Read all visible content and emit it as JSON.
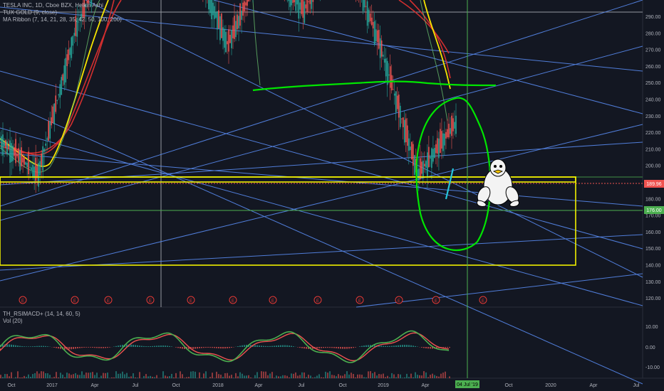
{
  "legend": {
    "symbol_line": "TESLA INC, 1D, Cboe BZX, Heikin Ashi",
    "indicator_1": "TUX GOLD (9, close)",
    "indicator_2": "MA Ribbon (7, 14, 21, 28, 35, 42, 50, 100, 200)",
    "oscillator_1": "TH_RSIMACD+ (14, 14, 60, 5)",
    "oscillator_2": "Vol (20)"
  },
  "price_axis": {
    "ticks": [
      "290.00",
      "280.00",
      "270.00",
      "260.00",
      "250.00",
      "240.00",
      "230.00",
      "220.00",
      "210.00",
      "200.00",
      "190.00",
      "180.00",
      "170.00",
      "160.00",
      "150.00",
      "140.00",
      "130.00",
      "120.00"
    ],
    "last_price_label": "189.96",
    "level_label": "176.00",
    "last_price_color": "#ef5350",
    "level_color": "#4caf50"
  },
  "osc_axis": {
    "ticks": [
      "10.00",
      "0.00",
      "-10.00"
    ]
  },
  "time_axis": {
    "ticks": [
      "Oct",
      "2017",
      "Apr",
      "Jul",
      "Oct",
      "2018",
      "Apr",
      "Jul",
      "Oct",
      "2019",
      "Apr",
      "Jul",
      "Oct",
      "2020",
      "Apr",
      "Jul"
    ],
    "crosshair_label": "04 Jul '19",
    "crosshair_color": "#4caf50"
  },
  "events": {
    "marker_label": "E",
    "count": 13
  },
  "chart_data": {
    "type": "line",
    "symbol": "TSLA",
    "x": [
      "2016-10",
      "2017-01",
      "2017-04",
      "2017-07",
      "2017-10",
      "2018-01",
      "2018-04",
      "2018-07",
      "2018-10",
      "2019-01",
      "2019-04",
      "2019-06",
      "2019-07"
    ],
    "series": [
      {
        "values": [
          215,
          195,
          280,
          330,
          350,
          325,
          270,
          320,
          290,
          330,
          270,
          195,
          225
        ]
      }
    ],
    "ylim": [
      118,
      296
    ],
    "levels": {
      "yellow_box_top": 195,
      "yellow_box_bottom": 143,
      "green_horizontal": 176,
      "last_price": 189.96
    },
    "grid": false,
    "colors": {
      "background": "#131722",
      "trendlines": "#5b8ff9",
      "drawing_green": "#00e600",
      "box_yellow": "#f0f000",
      "ma_yellow": "#f5e400",
      "ma_red": "#d32f2f"
    }
  }
}
